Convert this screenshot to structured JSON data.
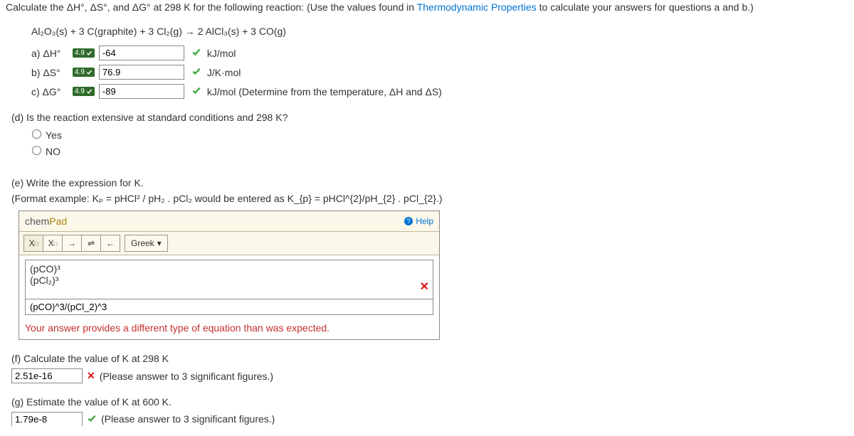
{
  "intro": {
    "pre": "Calculate the ΔH°, ΔS°, and ΔG° at 298 K for the following reaction: (Use the values found in ",
    "link": "Thermodynamic Properties",
    "post": " to calculate your answers for questions a and b.)"
  },
  "reaction": "Al₂O₃(s) + 3 C(graphite) + 3 Cl₂(g) → 2 AlCl₃(s) + 3 CO(g)",
  "parts": {
    "a": {
      "label": "a) ΔH°",
      "badge": "4.9",
      "value": "-64",
      "unit": "kJ/mol"
    },
    "b": {
      "label": "b) ΔS°",
      "badge": "4.9",
      "value": "76.9",
      "unit": "J/K·mol"
    },
    "c": {
      "label": "c) ΔG°",
      "badge": "4.9",
      "value": "-89",
      "unit": "kJ/mol (Determine from the temperature, ΔH and ΔS)"
    }
  },
  "d": {
    "prompt": "(d) Is the reaction extensive at standard conditions and 298 K?",
    "yes": "Yes",
    "no": "NO"
  },
  "e": {
    "l1": "(e) Write the expression for K.",
    "l2": "(Format example: Kₚ = pHCl² / pH₂ . pCl₂ would be entered as K_{p} = pHCl^{2}/pH_{2} . pCl_{2}.)",
    "chempad": "chemPad",
    "help": "Help",
    "greek": "Greek",
    "render_top": "(pCO)³",
    "render_bot": "(pCl₂)³",
    "raw": "(pCO)^3/(pCl_2)^3",
    "err": "Your answer provides a different type of equation than was expected."
  },
  "f": {
    "prompt": "(f) Calculate the value of K at 298 K",
    "value": "2.51e-16",
    "hint": "(Please answer to 3 significant figures.)"
  },
  "g": {
    "prompt": "(g) Estimate the value of K at 600 K.",
    "value": "1.79e-8",
    "hint": "(Please answer to 3 significant figures.)"
  }
}
